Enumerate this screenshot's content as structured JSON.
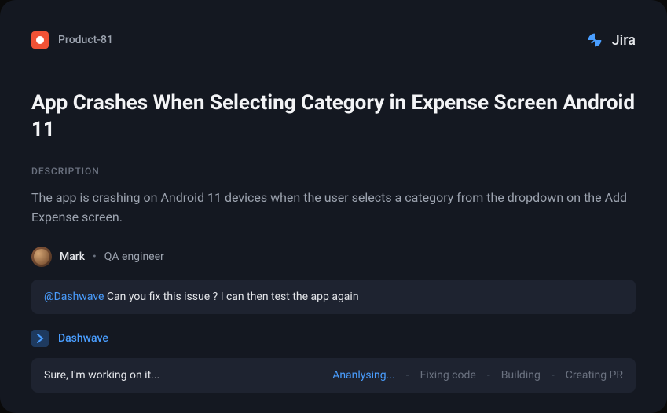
{
  "header": {
    "product_name": "Product-81",
    "brand_name": "Jira"
  },
  "ticket": {
    "title": "App Crashes When Selecting Category in Expense Screen Android 11",
    "section_label": "DESCRIPTION",
    "description": "The app is crashing on Android 11 devices when the user selects a category from the dropdown on the Add Expense screen."
  },
  "author": {
    "name": "Mark",
    "separator": "•",
    "role": "QA engineer"
  },
  "comment": {
    "mention": "@Dashwave",
    "text": " Can you fix this issue ? I can then test the app again"
  },
  "bot": {
    "name": "Dashwave"
  },
  "status": {
    "message": "Sure, I'm working on it...",
    "steps": [
      "Ananlysing...",
      "Fixing code",
      "Building",
      "Creating PR"
    ],
    "separator": "-",
    "active_index": 0
  }
}
